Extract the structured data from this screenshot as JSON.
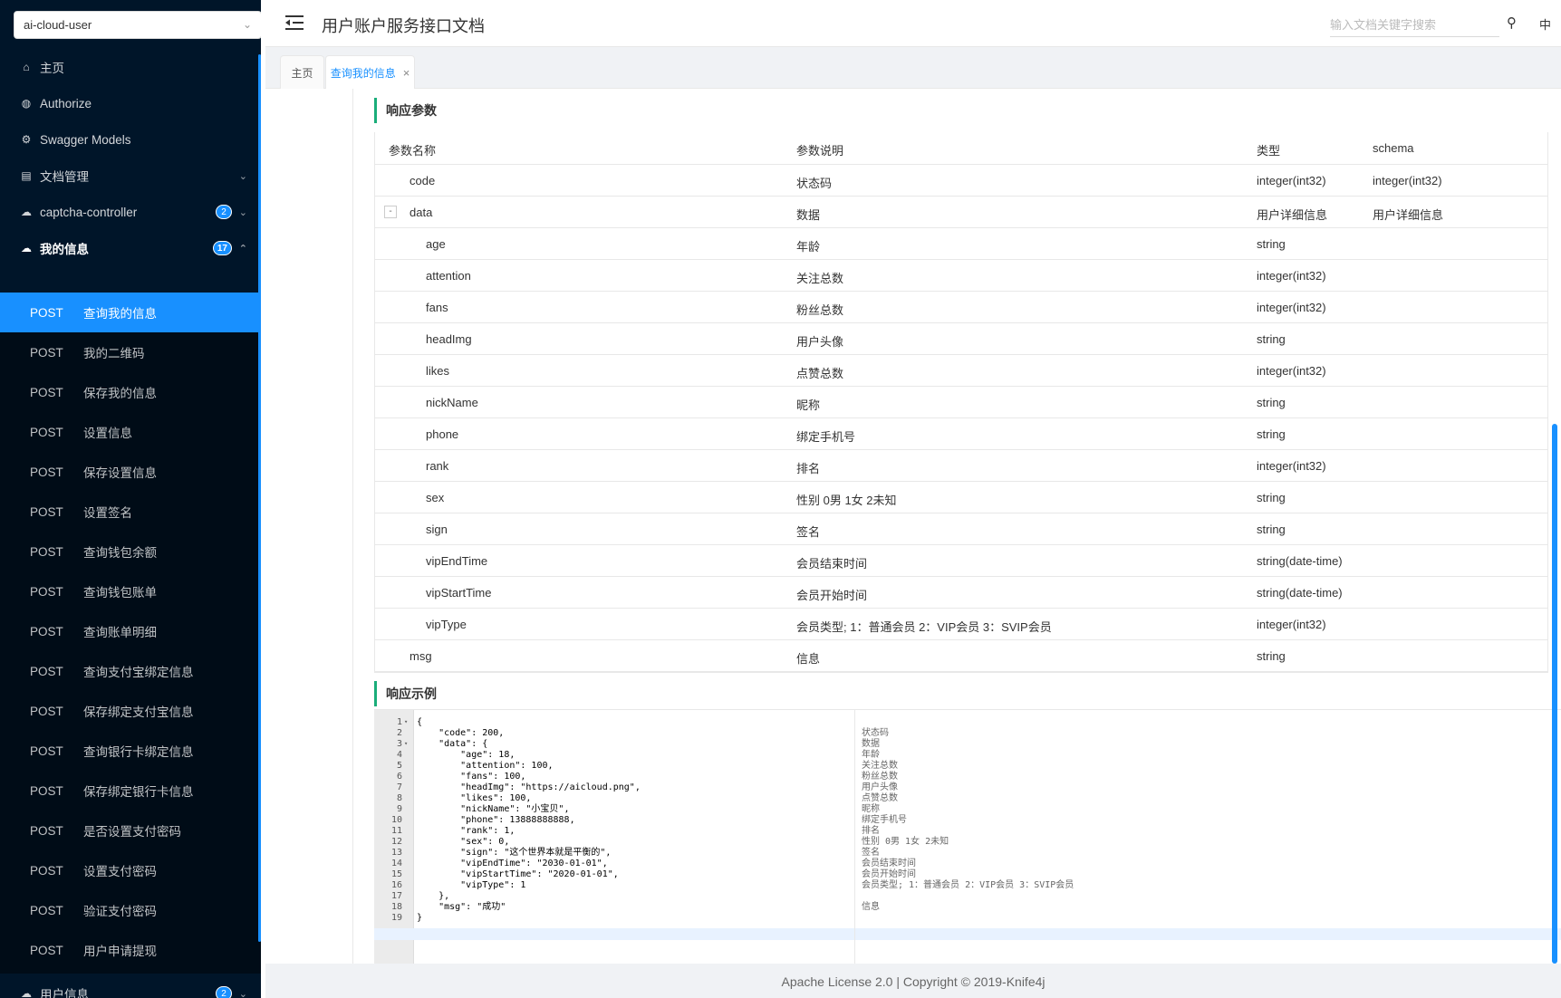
{
  "sidebar": {
    "service_select": "ai-cloud-user",
    "menu": [
      {
        "label": "主页",
        "icon": "home-icon"
      },
      {
        "label": "Authorize",
        "icon": "shield-icon"
      },
      {
        "label": "Swagger Models",
        "icon": "gear-icon"
      },
      {
        "label": "文档管理",
        "icon": "document-icon"
      },
      {
        "label": "captcha-controller",
        "icon": "cloud-icon",
        "badge": "2"
      },
      {
        "label": "我的信息",
        "icon": "cloud-icon",
        "badge": "17"
      }
    ],
    "submenu": [
      {
        "method": "POST",
        "label": "查询我的信息"
      },
      {
        "method": "POST",
        "label": "我的二维码"
      },
      {
        "method": "POST",
        "label": "保存我的信息"
      },
      {
        "method": "POST",
        "label": "设置信息"
      },
      {
        "method": "POST",
        "label": "保存设置信息"
      },
      {
        "method": "POST",
        "label": "设置签名"
      },
      {
        "method": "POST",
        "label": "查询钱包余额"
      },
      {
        "method": "POST",
        "label": "查询钱包账单"
      },
      {
        "method": "POST",
        "label": "查询账单明细"
      },
      {
        "method": "POST",
        "label": "查询支付宝绑定信息"
      },
      {
        "method": "POST",
        "label": "保存绑定支付宝信息"
      },
      {
        "method": "POST",
        "label": "查询银行卡绑定信息"
      },
      {
        "method": "POST",
        "label": "保存绑定银行卡信息"
      },
      {
        "method": "POST",
        "label": "是否设置支付密码"
      },
      {
        "method": "POST",
        "label": "设置支付密码"
      },
      {
        "method": "POST",
        "label": "验证支付密码"
      },
      {
        "method": "POST",
        "label": "用户申请提现"
      }
    ],
    "bottom_menu": {
      "label": "用户信息",
      "icon": "cloud-icon",
      "badge": "2"
    }
  },
  "header": {
    "title": "用户账户服务接口文档",
    "search_placeholder": "输入文档关键字搜索",
    "lang": "中"
  },
  "tabs": [
    {
      "label": "主页"
    },
    {
      "label": "查询我的信息",
      "close": "×"
    }
  ],
  "response_params": {
    "title": "响应参数",
    "columns": [
      "参数名称",
      "参数说明",
      "类型",
      "schema"
    ],
    "rows": [
      {
        "name": "code",
        "desc": "状态码",
        "type": "integer(int32)",
        "schema": "integer(int32)",
        "level": 0
      },
      {
        "name": "data",
        "desc": "数据",
        "type": "用户详细信息",
        "schema": "用户详细信息",
        "level": 0,
        "toggle": "-"
      },
      {
        "name": "age",
        "desc": "年龄",
        "type": "string",
        "schema": "",
        "level": 1
      },
      {
        "name": "attention",
        "desc": "关注总数",
        "type": "integer(int32)",
        "schema": "",
        "level": 1
      },
      {
        "name": "fans",
        "desc": "粉丝总数",
        "type": "integer(int32)",
        "schema": "",
        "level": 1
      },
      {
        "name": "headImg",
        "desc": "用户头像",
        "type": "string",
        "schema": "",
        "level": 1
      },
      {
        "name": "likes",
        "desc": "点赞总数",
        "type": "integer(int32)",
        "schema": "",
        "level": 1
      },
      {
        "name": "nickName",
        "desc": "昵称",
        "type": "string",
        "schema": "",
        "level": 1
      },
      {
        "name": "phone",
        "desc": "绑定手机号",
        "type": "string",
        "schema": "",
        "level": 1
      },
      {
        "name": "rank",
        "desc": "排名",
        "type": "integer(int32)",
        "schema": "",
        "level": 1
      },
      {
        "name": "sex",
        "desc": "性别 0男 1女 2未知",
        "type": "string",
        "schema": "",
        "level": 1
      },
      {
        "name": "sign",
        "desc": "签名",
        "type": "string",
        "schema": "",
        "level": 1
      },
      {
        "name": "vipEndTime",
        "desc": "会员结束时间",
        "type": "string(date-time)",
        "schema": "",
        "level": 1
      },
      {
        "name": "vipStartTime",
        "desc": "会员开始时间",
        "type": "string(date-time)",
        "schema": "",
        "level": 1
      },
      {
        "name": "vipType",
        "desc": "会员类型; 1：普通会员 2：VIP会员 3：SVIP会员",
        "type": "integer(int32)",
        "schema": "",
        "level": 1
      },
      {
        "name": "msg",
        "desc": "信息",
        "type": "string",
        "schema": "",
        "level": 0
      }
    ]
  },
  "response_example": {
    "title": "响应示例",
    "lines": [
      {
        "n": "1",
        "fold": "▾",
        "code": "{",
        "comment": ""
      },
      {
        "n": "2",
        "fold": "",
        "code": "    \"code\": 200,",
        "comment": "状态码"
      },
      {
        "n": "3",
        "fold": "▾",
        "code": "    \"data\": {",
        "comment": "数据"
      },
      {
        "n": "4",
        "fold": "",
        "code": "        \"age\": 18,",
        "comment": "年龄"
      },
      {
        "n": "5",
        "fold": "",
        "code": "        \"attention\": 100,",
        "comment": "关注总数"
      },
      {
        "n": "6",
        "fold": "",
        "code": "        \"fans\": 100,",
        "comment": "粉丝总数"
      },
      {
        "n": "7",
        "fold": "",
        "code": "        \"headImg\": \"https://aicloud.png\",",
        "comment": "用户头像"
      },
      {
        "n": "8",
        "fold": "",
        "code": "        \"likes\": 100,",
        "comment": "点赞总数"
      },
      {
        "n": "9",
        "fold": "",
        "code": "        \"nickName\": \"小宝贝\",",
        "comment": "昵称"
      },
      {
        "n": "10",
        "fold": "",
        "code": "        \"phone\": 13888888888,",
        "comment": "绑定手机号"
      },
      {
        "n": "11",
        "fold": "",
        "code": "        \"rank\": 1,",
        "comment": "排名"
      },
      {
        "n": "12",
        "fold": "",
        "code": "        \"sex\": 0,",
        "comment": "性别 0男 1女 2未知"
      },
      {
        "n": "13",
        "fold": "",
        "code": "        \"sign\": \"这个世界本就是平衡的\",",
        "comment": "签名"
      },
      {
        "n": "14",
        "fold": "",
        "code": "        \"vipEndTime\": \"2030-01-01\",",
        "comment": "会员结束时间"
      },
      {
        "n": "15",
        "fold": "",
        "code": "        \"vipStartTime\": \"2020-01-01\",",
        "comment": "会员开始时间"
      },
      {
        "n": "16",
        "fold": "",
        "code": "        \"vipType\": 1",
        "comment": "会员类型; 1：普通会员 2：VIP会员 3：SVIP会员"
      },
      {
        "n": "17",
        "fold": "",
        "code": "    },",
        "comment": ""
      },
      {
        "n": "18",
        "fold": "",
        "code": "    \"msg\": \"成功\"",
        "comment": "信息"
      },
      {
        "n": "19",
        "fold": "",
        "code": "}",
        "comment": ""
      }
    ]
  },
  "footer": {
    "text": "Apache License 2.0 | Copyright © 2019-Knife4j"
  },
  "colors": {
    "accent": "#1890ff",
    "sidebar_bg": "#001529",
    "section_bar": "#1aad7a"
  }
}
